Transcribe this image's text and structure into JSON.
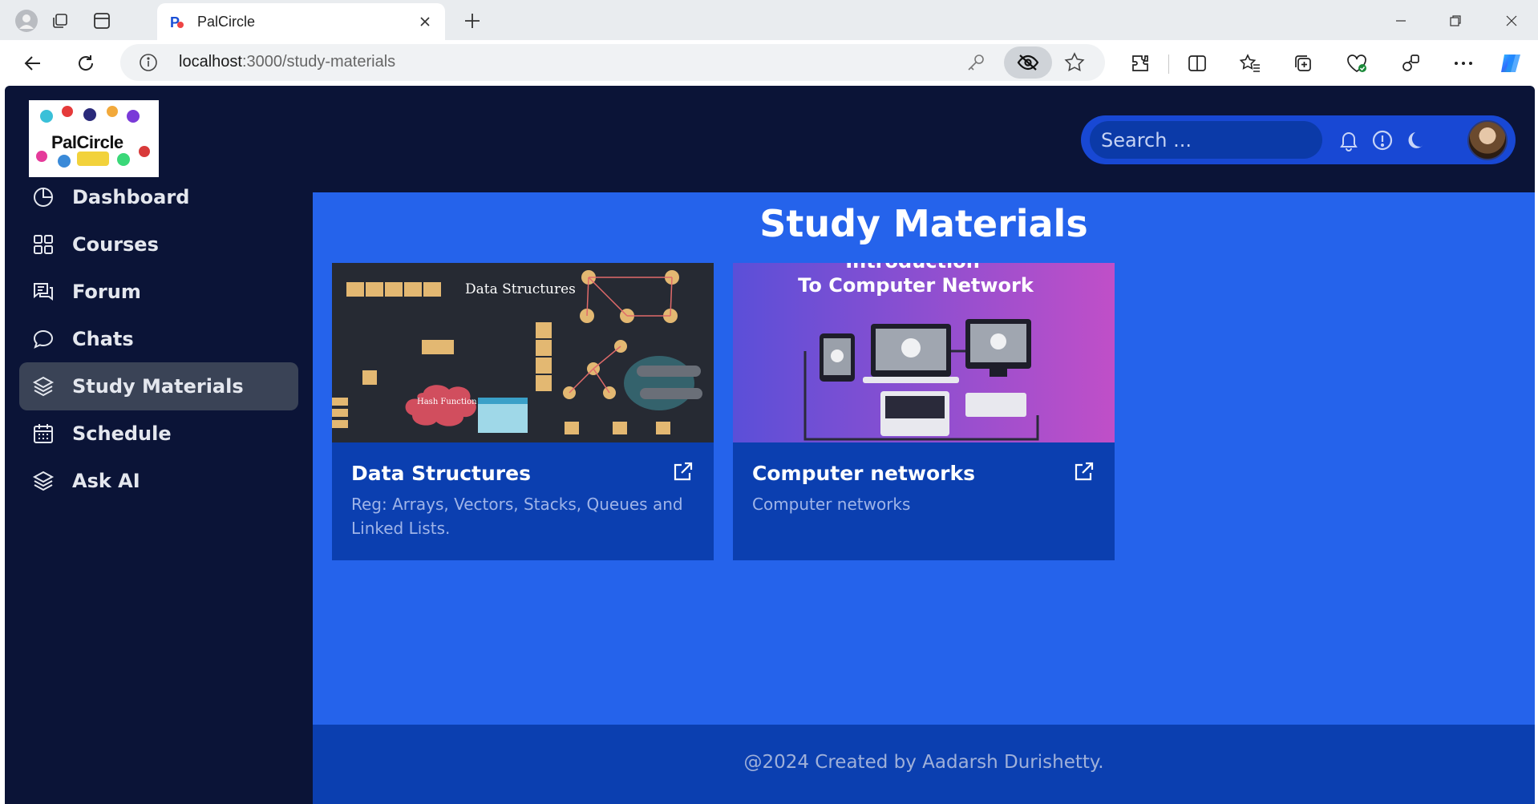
{
  "browser": {
    "tab_title": "PalCircle",
    "url_host": "localhost",
    "url_path": ":3000/study-materials"
  },
  "app": {
    "logo_text": "PalCircle",
    "sidebar": {
      "items": [
        {
          "label": "Dashboard",
          "icon": "pie-chart-icon",
          "active": false
        },
        {
          "label": "Courses",
          "icon": "grid-icon",
          "active": false
        },
        {
          "label": "Forum",
          "icon": "forum-icon",
          "active": false
        },
        {
          "label": "Chats",
          "icon": "chat-bubble-icon",
          "active": false
        },
        {
          "label": "Study Materials",
          "icon": "layers-icon",
          "active": true
        },
        {
          "label": "Schedule",
          "icon": "calendar-icon",
          "active": false
        },
        {
          "label": "Ask AI",
          "icon": "layers-icon",
          "active": false
        }
      ]
    },
    "header": {
      "search_placeholder": "Search ...",
      "icons": [
        "bell-icon",
        "info-icon",
        "moon-icon",
        "avatar"
      ]
    },
    "main": {
      "title": "Study Materials",
      "cards": [
        {
          "title": "Data Structures",
          "description": "Reg: Arrays, Vectors, Stacks, Queues and Linked Lists.",
          "image_label": "Data Structures",
          "image_tags": [
            "Hash Function"
          ]
        },
        {
          "title": "Computer networks",
          "description": "Computer networks",
          "image_label_line1": "Introduction",
          "image_label_line2": "To Computer Network"
        }
      ]
    },
    "footer": {
      "text": "@2024 Created by Aadarsh Durishetty."
    }
  },
  "colors": {
    "sidebar_bg": "#0b1437",
    "main_bg": "#2563eb",
    "card_bg": "#0b3fb0",
    "active_item_bg": "#3a4356",
    "search_bg": "#1848d4"
  }
}
